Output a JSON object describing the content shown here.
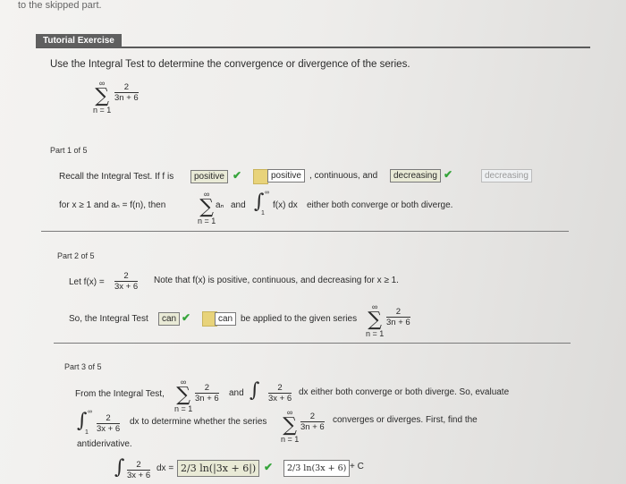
{
  "top_text": "to the skipped part.",
  "header": {
    "title": "Tutorial Exercise"
  },
  "question": "Use the Integral Test to determine the convergence or divergence of the series.",
  "series_main": {
    "top": "∞",
    "num": "2",
    "den": "3n + 6",
    "bottom": "n = 1"
  },
  "part1": {
    "label": "Part 1 of 5",
    "recall": "Recall the Integral Test. If f is",
    "answer1": "positive",
    "preview1": "positive",
    "mid": ", continuous, and",
    "answer2": "decreasing",
    "preview2": "decreasing",
    "line2a": "for x ≥ 1 and aₙ = f(n), then",
    "sum_term": "aₙ",
    "and": "and",
    "fx_dx": "f(x) dx",
    "tail": "either both converge or both diverge."
  },
  "part2": {
    "label": "Part 2 of 5",
    "let": "Let f(x) =",
    "num": "2",
    "den": "3x + 6",
    "note": "Note that f(x) is positive, continuous, and decreasing for x ≥ 1.",
    "so": "So, the Integral Test",
    "answer": "can",
    "preview": "can",
    "applied": "be applied to the given series"
  },
  "part3": {
    "label": "Part 3 of 5",
    "from": "From the Integral Test,",
    "and": "and",
    "either": "dx either both converge or both diverge. So, evaluate",
    "to_det": "dx to determine whether the series",
    "conv": "converges or diverges. First, find the",
    "antideriv": "antiderivative.",
    "answer": "2/3 ln(|3x + 6|)",
    "preview": "2/3 ln(3x + 6)",
    "plus_c": "+ C"
  },
  "colors": {
    "check": "#35a43a",
    "header_bg": "#5f5f5f"
  }
}
